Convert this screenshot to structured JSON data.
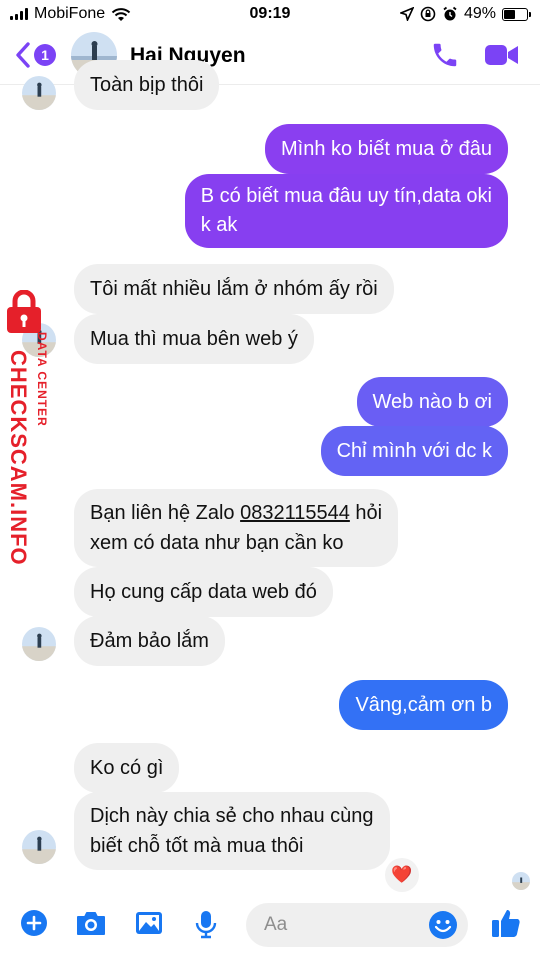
{
  "status": {
    "carrier": "MobiFone",
    "time": "09:19",
    "battery": "49%",
    "battery_level": 0.49
  },
  "header": {
    "back_count": "1",
    "contact_name": "Hai Nguyen"
  },
  "messages": [
    {
      "from": "them",
      "text": "Toàn bịp thôi"
    },
    {
      "from": "me",
      "text": "Mình ko biết mua ở đâu"
    },
    {
      "from": "me",
      "line1": "B có biết mua đâu uy tín,data oki",
      "line2": "k ak"
    },
    {
      "from": "them",
      "text": "Tôi mất nhiều lắm ở nhóm ấy rồi"
    },
    {
      "from": "them",
      "text": "Mua thì mua bên web ý"
    },
    {
      "from": "me",
      "text": "Web nào b ơi"
    },
    {
      "from": "me",
      "text": "Chỉ mình với dc k"
    },
    {
      "from": "them",
      "line1_prefix": "Bạn liên hệ Zalo ",
      "phone": "0832115544",
      "line1_suffix": " hỏi",
      "line2": "xem có data như bạn cần ko"
    },
    {
      "from": "them",
      "text": "Họ cung cấp data web đó"
    },
    {
      "from": "them",
      "text": "Đảm bảo lắm"
    },
    {
      "from": "me",
      "text": "Vâng,cảm ơn b"
    },
    {
      "from": "them",
      "text": "Ko có gì"
    },
    {
      "from": "them",
      "line1": "Dịch này chia sẻ cho nhau cùng",
      "line2": "biết chỗ tốt mà mua thôi"
    }
  ],
  "reaction": "❤️",
  "watermark": {
    "text": "CHECKSCAM.INFO",
    "sub": "DATA CENTER"
  },
  "composer": {
    "placeholder": "Aa"
  },
  "colors": {
    "accent": "#7b43f5",
    "bubble_in": "#efefef",
    "bubble_out_top": "#8a3ff0",
    "bubble_out_bottom": "#2f6ff5",
    "watermark": "#e5202a"
  },
  "icons": [
    "signal-icon",
    "wifi-icon",
    "location-icon",
    "lock-rotation-icon",
    "alarm-icon",
    "battery-icon",
    "back-chevron-icon",
    "phone-icon",
    "video-icon",
    "plus-icon",
    "camera-icon",
    "image-icon",
    "mic-icon",
    "emoji-icon",
    "thumbs-up-icon",
    "padlock-icon"
  ]
}
